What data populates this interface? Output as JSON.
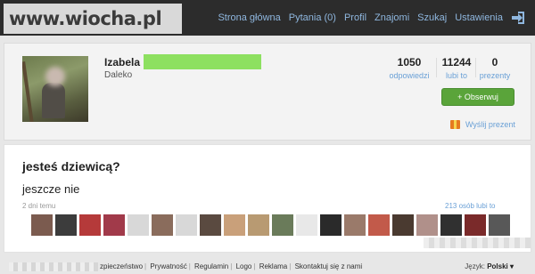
{
  "watermark": "www.wiocha.pl",
  "nav": {
    "items": [
      "Strona główna",
      "Pytania (0)",
      "Profil",
      "Znajomi",
      "Szukaj",
      "Ustawienia"
    ],
    "logout_icon": "logout-icon"
  },
  "profile": {
    "name": "Izabela",
    "location": "Daleko",
    "stats": [
      {
        "value": "1050",
        "label": "odpowiedzi"
      },
      {
        "value": "11244",
        "label": "lubi to"
      },
      {
        "value": "0",
        "label": "prezenty"
      }
    ],
    "follow_label": "+ Obserwuj",
    "gift_label": "Wyślij prezent"
  },
  "question": {
    "text": "jesteś dziewicą?",
    "answer": "jeszcze nie",
    "time": "2 dni temu",
    "likes": "213 osób lubi to"
  },
  "footer": {
    "links": [
      "zpieczeństwo",
      "Prywatność",
      "Regulamin",
      "Logo",
      "Reklama",
      "Skontaktuj się z nami"
    ],
    "lang_label": "Język:",
    "lang_value": "Polski ▾"
  },
  "colors": {
    "topbar": "#2c2c2c",
    "link": "#8fb7df",
    "accent_blue": "#6aa0d6",
    "button_green": "#5aa43a",
    "censor_green": "#8de060"
  }
}
